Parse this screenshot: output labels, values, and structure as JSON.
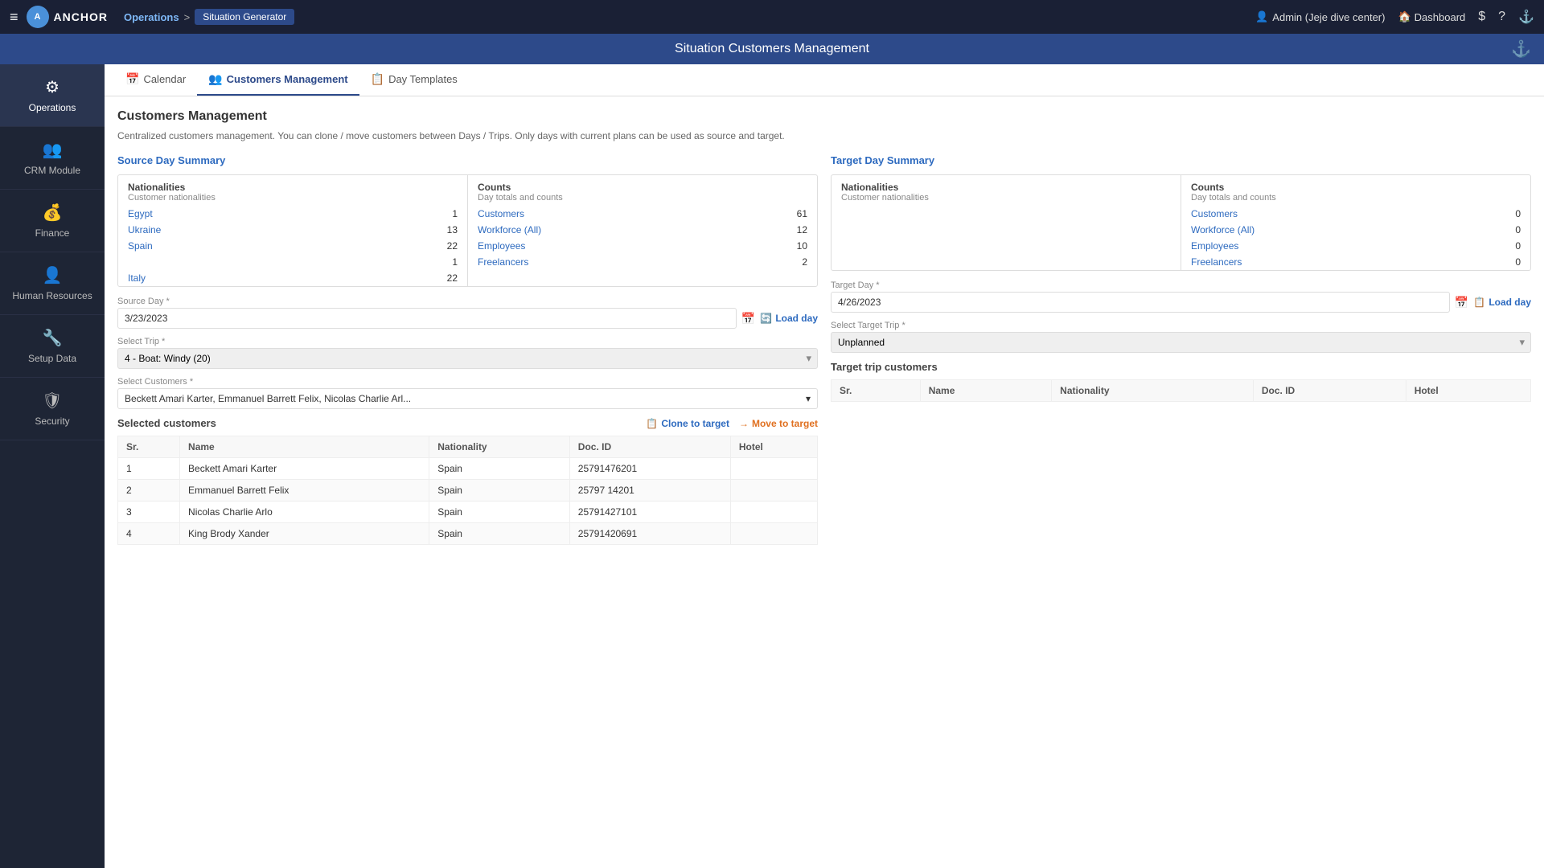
{
  "topBar": {
    "hamburger": "≡",
    "logoText": "ANCHOR",
    "breadcrumb": {
      "operations": "Operations",
      "separator": ">",
      "current": "Situation Generator"
    },
    "userLabel": "Admin (Jeje dive center)",
    "dashboardLabel": "Dashboard",
    "dollarIcon": "$",
    "helpIcon": "?",
    "anchorIcon": "⚓"
  },
  "subtitleBar": {
    "title": "Situation Customers Management",
    "anchorIcon": "⚓"
  },
  "sidebar": {
    "items": [
      {
        "id": "operations",
        "icon": "⚙",
        "label": "Operations",
        "active": true
      },
      {
        "id": "crm-module",
        "icon": "👥",
        "label": "CRM Module",
        "active": false
      },
      {
        "id": "finance",
        "icon": "💰",
        "label": "Finance",
        "active": false
      },
      {
        "id": "human-resources",
        "icon": "👤",
        "label": "Human Resources",
        "active": false
      },
      {
        "id": "setup-data",
        "icon": "🔧",
        "label": "Setup Data",
        "active": false
      },
      {
        "id": "security",
        "icon": "🛡",
        "label": "Security",
        "active": false
      }
    ]
  },
  "tabs": [
    {
      "id": "calendar",
      "icon": "📅",
      "label": "Calendar",
      "active": false
    },
    {
      "id": "customers-management",
      "icon": "👥",
      "label": "Customers Management",
      "active": true
    },
    {
      "id": "day-templates",
      "icon": "📋",
      "label": "Day Templates",
      "active": false
    }
  ],
  "pageTitle": "Customers Management",
  "pageDesc": "Centralized customers management. You can clone / move customers between Days / Trips. Only days with current plans can be used as source and target.",
  "source": {
    "sectionTitle": "Source Day Summary",
    "nationalitiesHeader": "Nationalities",
    "nationalitiesSub": "Customer nationalities",
    "nationalities": [
      {
        "name": "Egypt",
        "count": "1"
      },
      {
        "name": "Ukraine",
        "count": "13"
      },
      {
        "name": "Spain",
        "count": "22"
      },
      {
        "name": "",
        "count": "1"
      },
      {
        "name": "Italy",
        "count": "22"
      }
    ],
    "countsHeader": "Counts",
    "countsSub": "Day totals and counts",
    "counts": [
      {
        "name": "Customers",
        "value": "61"
      },
      {
        "name": "Workforce (All)",
        "value": "12"
      },
      {
        "name": "Employees",
        "value": "10"
      },
      {
        "name": "Freelancers",
        "value": "2"
      }
    ],
    "sourceDayLabel": "Source Day *",
    "sourceDayValue": "3/23/2023",
    "sourceDayPlaceholder": "MM/DD/YYYY",
    "selectTripLabel": "Select Trip *",
    "selectedTrip": "4 - Boat: Windy (20)",
    "selectCustomersLabel": "Select Customers *",
    "selectedCustomers": "Beckett Amari Karter, Emmanuel Barrett Felix, Nicolas Charlie Arl...",
    "loadDayLabel": "Load day"
  },
  "selectedCustomers": {
    "sectionTitle": "Selected customers",
    "cloneLabel": "Clone to target",
    "moveLabel": "Move to target",
    "columns": [
      "Sr.",
      "Name",
      "Nationality",
      "Doc. ID",
      "Hotel"
    ],
    "rows": [
      {
        "sr": "1",
        "name": "Beckett Amari Karter",
        "nationality": "Spain",
        "docId": "25791476201",
        "hotel": ""
      },
      {
        "sr": "2",
        "name": "Emmanuel Barrett Felix",
        "nationality": "Spain",
        "docId": "25797 14201",
        "hotel": ""
      },
      {
        "sr": "3",
        "name": "Nicolas Charlie Arlo",
        "nationality": "Spain",
        "docId": "25791427101",
        "hotel": ""
      },
      {
        "sr": "4",
        "name": "King Brody Xander",
        "nationality": "Spain",
        "docId": "25791420691",
        "hotel": ""
      }
    ]
  },
  "target": {
    "sectionTitle": "Target Day Summary",
    "nationalitiesHeader": "Nationalities",
    "nationalitiesSub": "Customer nationalities",
    "nationalities": [],
    "countsHeader": "Counts",
    "countsSub": "Day totals and counts",
    "counts": [
      {
        "name": "Customers",
        "value": "0"
      },
      {
        "name": "Workforce (All)",
        "value": "0"
      },
      {
        "name": "Employees",
        "value": "0"
      },
      {
        "name": "Freelancers",
        "value": "0"
      }
    ],
    "targetDayLabel": "Target Day *",
    "targetDayValue": "4/26/2023",
    "targetDayPlaceholder": "MM/DD/YYYY",
    "selectTargetTripLabel": "Select Target Trip *",
    "selectedTargetTrip": "Unplanned",
    "loadDayLabel": "Load day",
    "tripCustomersTitle": "Target trip customers",
    "columns": [
      "Sr.",
      "Name",
      "Nationality",
      "Doc. ID",
      "Hotel"
    ],
    "rows": []
  }
}
